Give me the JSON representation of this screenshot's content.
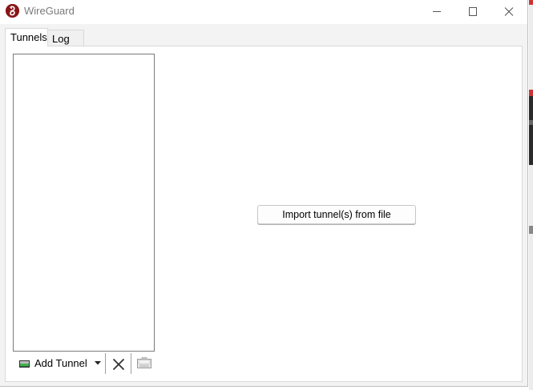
{
  "window": {
    "title": "WireGuard",
    "controls": {
      "minimize_icon": "minimize-icon",
      "maximize_icon": "maximize-icon",
      "close_icon": "close-icon"
    }
  },
  "tabs": [
    {
      "label": "Tunnels",
      "active": true
    },
    {
      "label": "Log",
      "active": false
    }
  ],
  "tunnels": {
    "items": []
  },
  "toolbar": {
    "add_tunnel_label": "Add Tunnel",
    "add_tunnel_icon": "add-tunnel-icon",
    "dropdown_icon": "chevron-down-icon",
    "delete_icon": "close-icon",
    "export_icon": "export-zip-icon"
  },
  "main": {
    "import_button_label": "Import tunnel(s) from file"
  },
  "colors": {
    "brand": "#88171a",
    "window_bg": "#f3f3f3",
    "panel_bg": "#ffffff",
    "add_icon_green": "#3fb34f"
  }
}
